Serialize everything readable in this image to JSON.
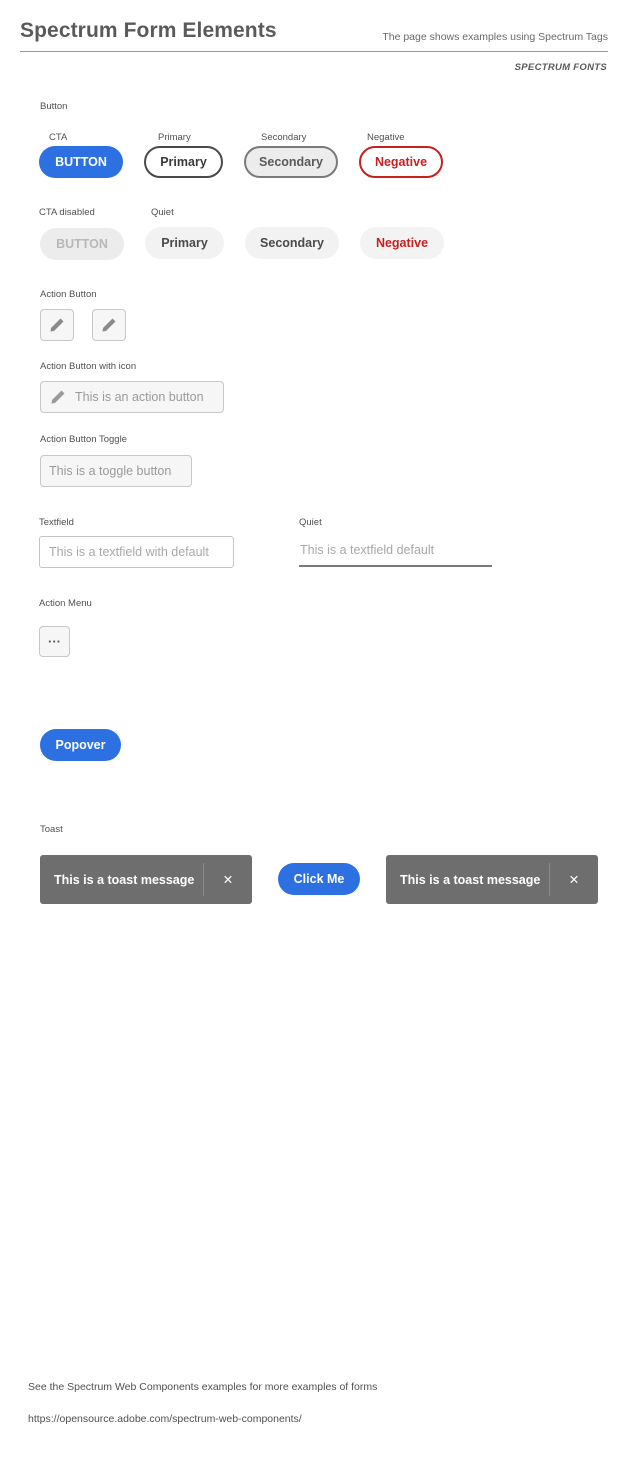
{
  "header": {
    "title": "Spectrum Form Elements",
    "subtitle": "The page shows examples using Spectrum Tags",
    "fonts_label": "SPECTRUM FONTS"
  },
  "button_section": {
    "label": "Button",
    "row1": {
      "cta_label": "CTA",
      "cta_text": "BUTTON",
      "primary_label": "Primary",
      "primary_text": "Primary",
      "secondary_label": "Secondary",
      "secondary_text": "Secondary",
      "negative_label": "Negative",
      "negative_text": "Negative"
    },
    "row2": {
      "cta_disabled_label": "CTA disabled",
      "cta_disabled_text": "BUTTON",
      "quiet_label": "Quiet",
      "quiet_primary_text": "Primary",
      "quiet_secondary_text": "Secondary",
      "quiet_negative_text": "Negative"
    }
  },
  "action_button": {
    "label": "Action Button"
  },
  "action_button_icon": {
    "label": "Action Button with icon",
    "text": "This is an action button"
  },
  "action_button_toggle": {
    "label": "Action Button Toggle",
    "text": "This is a toggle button"
  },
  "textfield": {
    "label": "Textfield",
    "placeholder": "This is a textfield with default",
    "quiet_label": "Quiet",
    "quiet_placeholder": "This is a textfield default"
  },
  "action_menu": {
    "label": "Action Menu",
    "glyph": "···"
  },
  "popover": {
    "text": "Popover"
  },
  "toast": {
    "label": "Toast",
    "left_message": "This is a toast message",
    "button_text": "Click Me",
    "right_message": "This is a toast message",
    "close_glyph": "✕"
  },
  "footer": {
    "note": "See the Spectrum Web Components examples for more examples of forms",
    "url": "https://opensource.adobe.com/spectrum-web-components/"
  },
  "colors": {
    "accent": "#2d70e2",
    "negative": "#c62121",
    "toast": "#6e6e6e"
  }
}
